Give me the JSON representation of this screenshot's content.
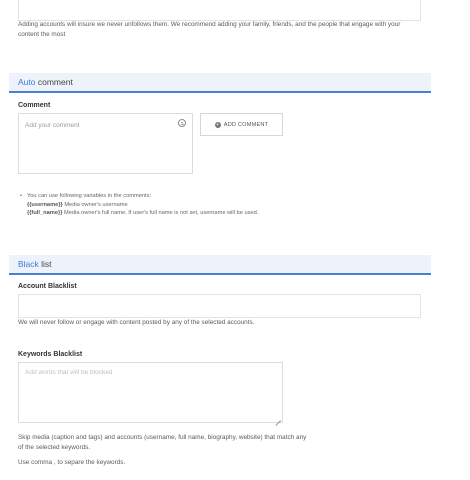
{
  "top_note": "Adding accounts will insure we never unfollows them. We recommend adding your family, friends, and the people that engage with your content the most",
  "auto_comment": {
    "title_accent": "Auto",
    "title_rest": " comment",
    "comment_label": "Comment",
    "comment_placeholder": "Add your comment",
    "add_button": "ADD COMMENT",
    "add_icon": "+",
    "vars_intro": "You can use following variables in the comments:",
    "var1_name": "{{username}}",
    "var1_desc": " Media owner's username",
    "var2_name": "{{full_name}}",
    "var2_desc": " Media owner's full name. If user's full name is not set, username will be used.",
    "bullet": "•"
  },
  "black_list": {
    "title_accent": "Black",
    "title_rest": " list",
    "account_label": "Account Blacklist",
    "account_note": "We will never follow or engage with content posted by any of the selected accounts.",
    "keywords_label": "Keywords Blacklist",
    "keywords_placeholder": "Add words that will be blocked",
    "skip_note": "Skip media (caption and tags) and accounts (username, full name, biography, website) that match any of the selected keywords.",
    "comma_note": "Use comma , to separe the keywords."
  },
  "colors": {
    "accent": "#3d78d8",
    "header_bg": "#eef3fb"
  }
}
